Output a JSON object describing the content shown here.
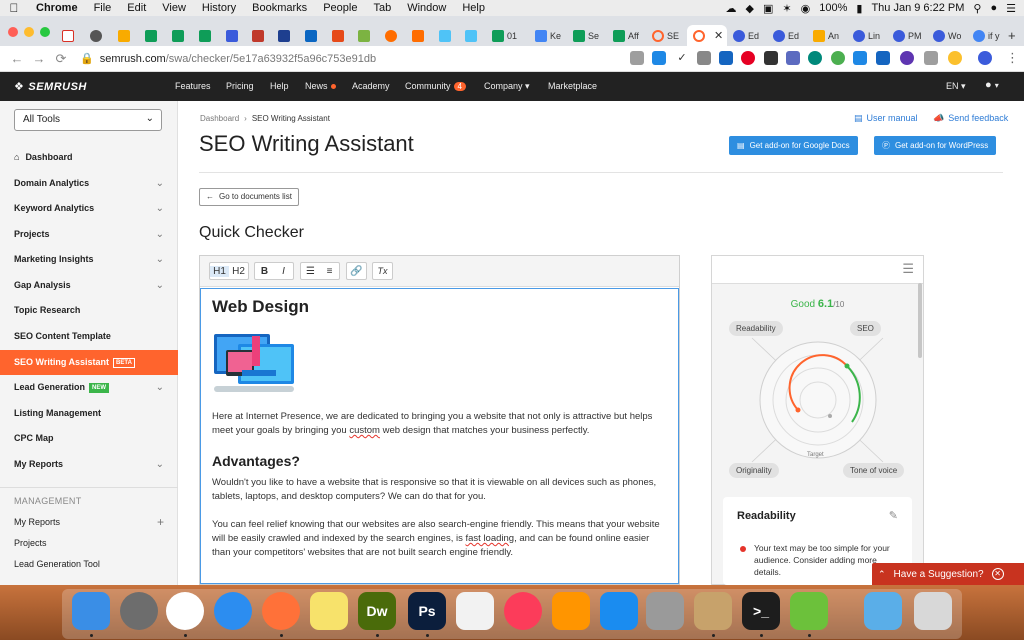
{
  "menubar": {
    "items": [
      "Chrome",
      "File",
      "Edit",
      "View",
      "History",
      "Bookmarks",
      "People",
      "Tab",
      "Window",
      "Help"
    ],
    "battery": "100%",
    "clock": "Thu Jan 9  6:22 PM"
  },
  "tabs": [
    {
      "label": "01",
      "color": "#0f9d58"
    },
    {
      "label": "Ke",
      "color": "#4285f4"
    },
    {
      "label": "Se",
      "color": "#0f9d58"
    },
    {
      "label": "Aff",
      "color": "#0f9d58"
    },
    {
      "label": "SE",
      "color": "#ff642d"
    },
    {
      "label": "Ed",
      "color": "#3b5bdb"
    },
    {
      "label": "Ed",
      "color": "#3b5bdb"
    },
    {
      "label": "An",
      "color": "#f9ab00"
    },
    {
      "label": "Lin",
      "color": "#3b5bdb"
    },
    {
      "label": "PM",
      "color": "#3b5bdb"
    },
    {
      "label": "Wo",
      "color": "#3b5bdb"
    },
    {
      "label": "if y",
      "color": "#4285f4"
    }
  ],
  "address": {
    "host": "semrush.com",
    "path": "/swa/checker/5e17a63932f5a96c753e91db"
  },
  "semrush_nav": {
    "logo": "SEMRUSH",
    "items": [
      "Features",
      "Pricing",
      "Help",
      "News",
      "Academy",
      "Community",
      "Company",
      "Marketplace"
    ],
    "community_badge": "4",
    "lang": "EN"
  },
  "sidebar": {
    "all_tools": "All Tools",
    "items": [
      {
        "label": "Dashboard"
      },
      {
        "label": "Domain Analytics"
      },
      {
        "label": "Keyword Analytics"
      },
      {
        "label": "Projects"
      },
      {
        "label": "Marketing Insights"
      },
      {
        "label": "Gap Analysis"
      },
      {
        "label": "Topic Research"
      },
      {
        "label": "SEO Content Template"
      },
      {
        "label": "SEO Writing Assistant",
        "tag": "BETA"
      },
      {
        "label": "Lead Generation",
        "tag": "NEW"
      },
      {
        "label": "Listing Management"
      },
      {
        "label": "CPC Map"
      },
      {
        "label": "My Reports"
      }
    ],
    "management_header": "MANAGEMENT",
    "management_items": [
      "My Reports",
      "Projects",
      "Lead Generation Tool"
    ]
  },
  "breadcrumb": {
    "home": "Dashboard",
    "current": "SEO Writing Assistant"
  },
  "page_title": "SEO Writing Assistant",
  "user_manual": "User manual",
  "send_feedback": "Send feedback",
  "btn_docs": "Get add-on for Google Docs",
  "btn_wp": "Get add-on for WordPress",
  "back_btn": "Go to documents list",
  "section_title": "Quick Checker",
  "toolbar": {
    "h1": "H1",
    "h2": "H2",
    "bold": "B",
    "italic": "I",
    "clear": "Tx"
  },
  "document": {
    "h1": "Web Design",
    "p1_a": "Here at Internet Presence, we are dedicated to bringing you a website that not only is attractive but helps meet your goals by bringing you ",
    "p1_squig": "custom",
    "p1_b": " web design that matches your business perfectly.",
    "h2": "Advantages?",
    "p2": "Wouldn't you like to have a website that is responsive so that it is viewable on all devices such as phones, tablets, laptops, and desktop computers? We can do that for you.",
    "p3_a": "You can feel relief knowing that our websites are also search-engine friendly. This means that your website will be easily crawled and indexed by the search engines, is ",
    "p3_squig": "fast loading",
    "p3_b": ", and can be found online easier than your competitors' websites that are not built search engine friendly."
  },
  "score_panel": {
    "rating": "Good",
    "score": "6.1",
    "out_of": "/10",
    "quadrants": [
      "Readability",
      "SEO",
      "Originality",
      "Tone of voice"
    ],
    "target_label": "Target",
    "accent_green": "#3bb54a",
    "accent_orange": "#ff642d"
  },
  "readability_card": {
    "title": "Readability",
    "message": "Your text may be too simple for your audience. Consider adding more details."
  },
  "suggestion": "Have a Suggestion?",
  "dock": {
    "apps": [
      {
        "name": "finder-icon",
        "label": "",
        "color": "#3a8ee6"
      },
      {
        "name": "launchpad-icon",
        "label": "",
        "color": "#6d6d6d"
      },
      {
        "name": "chrome-icon",
        "label": "",
        "color": "#ffffff"
      },
      {
        "name": "safari-icon",
        "label": "",
        "color": "#2c8df0"
      },
      {
        "name": "firefox-icon",
        "label": "",
        "color": "#ff7139"
      },
      {
        "name": "notes-icon",
        "label": "",
        "color": "#f7e26b"
      },
      {
        "name": "dreamweaver-icon",
        "label": "Dw",
        "color": "#4a6b0a"
      },
      {
        "name": "photoshop-icon",
        "label": "Ps",
        "color": "#0b1e3c"
      },
      {
        "name": "reminders-icon",
        "label": "",
        "color": "#f2f2f2"
      },
      {
        "name": "music-icon",
        "label": "",
        "color": "#fc3c5a"
      },
      {
        "name": "books-icon",
        "label": "",
        "color": "#ff9500"
      },
      {
        "name": "app-store-icon",
        "label": "",
        "color": "#1a8cf0"
      },
      {
        "name": "calculator-icon",
        "label": "",
        "color": "#9a9a9a"
      },
      {
        "name": "preview-icon",
        "label": "",
        "color": "#c7a26b"
      },
      {
        "name": "terminal-icon",
        "label": ">_",
        "color": "#1d1d1d"
      },
      {
        "name": "magnifier-app-icon",
        "label": "",
        "color": "#6cc13b"
      },
      {
        "name": "folder-icon",
        "label": "",
        "color": "#5aaee8"
      },
      {
        "name": "trash-icon",
        "label": "",
        "color": "#d8d8d8"
      }
    ]
  }
}
